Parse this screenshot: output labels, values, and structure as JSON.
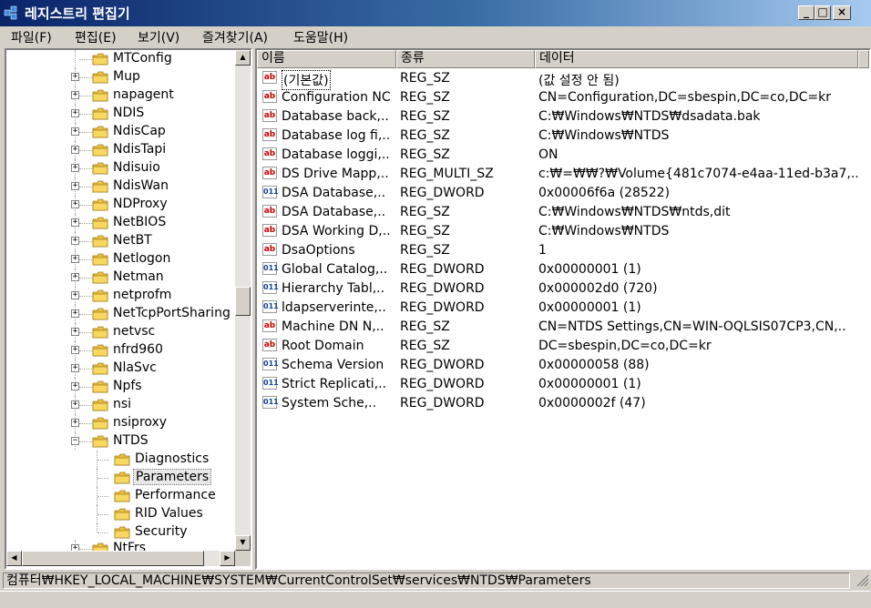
{
  "window": {
    "title": "레지스트리 편집기"
  },
  "menu": [
    "파일(F)",
    "편집(E)",
    "보기(V)",
    "즐겨찾기(A)",
    "도움말(H)"
  ],
  "tree": {
    "items": [
      {
        "label": "MTConfig",
        "expandable": false
      },
      {
        "label": "Mup",
        "expandable": true
      },
      {
        "label": "napagent",
        "expandable": true
      },
      {
        "label": "NDIS",
        "expandable": true
      },
      {
        "label": "NdisCap",
        "expandable": true
      },
      {
        "label": "NdisTapi",
        "expandable": true
      },
      {
        "label": "Ndisuio",
        "expandable": true
      },
      {
        "label": "NdisWan",
        "expandable": true
      },
      {
        "label": "NDProxy",
        "expandable": true
      },
      {
        "label": "NetBIOS",
        "expandable": true
      },
      {
        "label": "NetBT",
        "expandable": true
      },
      {
        "label": "Netlogon",
        "expandable": true
      },
      {
        "label": "Netman",
        "expandable": true
      },
      {
        "label": "netprofm",
        "expandable": true
      },
      {
        "label": "NetTcpPortSharing",
        "expandable": true
      },
      {
        "label": "netvsc",
        "expandable": true
      },
      {
        "label": "nfrd960",
        "expandable": true
      },
      {
        "label": "NlaSvc",
        "expandable": true
      },
      {
        "label": "Npfs",
        "expandable": true
      },
      {
        "label": "nsi",
        "expandable": true
      },
      {
        "label": "nsiproxy",
        "expandable": true
      },
      {
        "label": "NTDS",
        "expandable": true,
        "expanded": true
      },
      {
        "label": "Diagnostics",
        "child": true
      },
      {
        "label": "Parameters",
        "child": true,
        "selected": true
      },
      {
        "label": "Performance",
        "child": true
      },
      {
        "label": "RID Values",
        "child": true
      },
      {
        "label": "Security",
        "child": true
      },
      {
        "label": "NtFrs",
        "expandable": true,
        "partial": true
      }
    ]
  },
  "list": {
    "columns": [
      "이름",
      "종류",
      "데이터"
    ],
    "rows": [
      {
        "icon": "string",
        "name": "(기본값)",
        "type": "REG_SZ",
        "data": "(값 설정 안 됨)"
      },
      {
        "icon": "string",
        "name": "Configuration NC",
        "type": "REG_SZ",
        "data": "CN=Configuration,DC=sbespin,DC=co,DC=kr"
      },
      {
        "icon": "string",
        "name": "Database back,..",
        "type": "REG_SZ",
        "data": "C:₩Windows₩NTDS₩dsadata.bak"
      },
      {
        "icon": "string",
        "name": "Database log fi,..",
        "type": "REG_SZ",
        "data": "C:₩Windows₩NTDS"
      },
      {
        "icon": "string",
        "name": "Database loggi,..",
        "type": "REG_SZ",
        "data": "ON"
      },
      {
        "icon": "string",
        "name": "DS Drive Mapp,..",
        "type": "REG_MULTI_SZ",
        "data": "c:₩=₩₩?₩Volume{481c7074-e4aa-11ed-b3a7,.."
      },
      {
        "icon": "dword",
        "name": "DSA Database,..",
        "type": "REG_DWORD",
        "data": "0x00006f6a (28522)"
      },
      {
        "icon": "string",
        "name": "DSA Database,..",
        "type": "REG_SZ",
        "data": "C:₩Windows₩NTDS₩ntds,dit"
      },
      {
        "icon": "string",
        "name": "DSA Working D,..",
        "type": "REG_SZ",
        "data": "C:₩Windows₩NTDS"
      },
      {
        "icon": "string",
        "name": "DsaOptions",
        "type": "REG_SZ",
        "data": "1"
      },
      {
        "icon": "dword",
        "name": "Global Catalog,..",
        "type": "REG_DWORD",
        "data": "0x00000001 (1)"
      },
      {
        "icon": "dword",
        "name": "Hierarchy Tabl,..",
        "type": "REG_DWORD",
        "data": "0x000002d0 (720)"
      },
      {
        "icon": "dword",
        "name": "ldapserverinte,..",
        "type": "REG_DWORD",
        "data": "0x00000001 (1)"
      },
      {
        "icon": "string",
        "name": "Machine DN N,..",
        "type": "REG_SZ",
        "data": "CN=NTDS Settings,CN=WIN-OQLSIS07CP3,CN,.."
      },
      {
        "icon": "string",
        "name": "Root Domain",
        "type": "REG_SZ",
        "data": "DC=sbespin,DC=co,DC=kr"
      },
      {
        "icon": "dword",
        "name": "Schema Version",
        "type": "REG_DWORD",
        "data": "0x00000058 (88)"
      },
      {
        "icon": "dword",
        "name": "Strict Replicati,..",
        "type": "REG_DWORD",
        "data": "0x00000001 (1)"
      },
      {
        "icon": "dword",
        "name": "System Sche,..",
        "type": "REG_DWORD",
        "data": "0x0000002f (47)"
      }
    ]
  },
  "status": {
    "path": "컴퓨터₩HKEY_LOCAL_MACHINE₩SYSTEM₩CurrentControlSet₩services₩NTDS₩Parameters"
  },
  "icons": {
    "string": "ab",
    "dword": "011\n110"
  },
  "colors": {
    "titlebar_start": "#0a246a",
    "titlebar_end": "#a6caf0",
    "window_bg": "#d4d0c8",
    "folder": "#f0c040"
  }
}
